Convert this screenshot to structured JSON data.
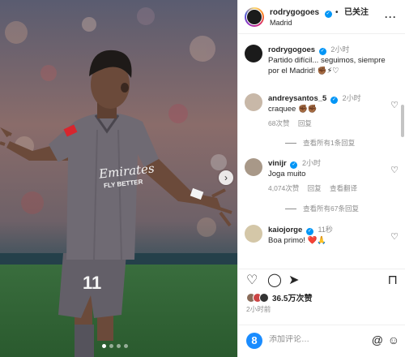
{
  "post": {
    "username": "rodrygogoes",
    "follow_label": "已关注",
    "location": "Madrid",
    "more_label": "···",
    "next_label": "›",
    "likes_text": "36.5万次赞",
    "time_ago": "2小时前",
    "jersey_number": "11",
    "sponsor_line1": "Emirates",
    "sponsor_line2": "FLY BETTER"
  },
  "comments": [
    {
      "username": "rodrygogoes",
      "time": "2小时",
      "text": "Partido difícil... seguimos, siempre por el Madrid! ✊🏾⚡♡"
    },
    {
      "username": "andreysantos_5",
      "time": "2小时",
      "text": "craquee ✊🏾✊🏾",
      "likes": "68次赞",
      "reply": "回复",
      "replies": "查看所有1条回复"
    },
    {
      "username": "vinijr",
      "time": "2小时",
      "text": "Joga muito",
      "likes": "4,074次赞",
      "reply": "回复",
      "translate": "查看翻译",
      "replies": "查看所有67条回复"
    },
    {
      "username": "kaiojorge",
      "time": "11秒",
      "text": "Boa primo! ❤️🙏"
    }
  ],
  "add_comment": {
    "placeholder": "添加评论…",
    "post_label": "@"
  },
  "icons": {
    "like": "heart-icon",
    "comment": "comment-icon",
    "share": "send-icon",
    "save": "bookmark-icon",
    "emoji": "emoji-icon"
  },
  "colors": {
    "accent": "#0095f6",
    "jersey": "#6b6670",
    "badge": "#1a8cff"
  }
}
